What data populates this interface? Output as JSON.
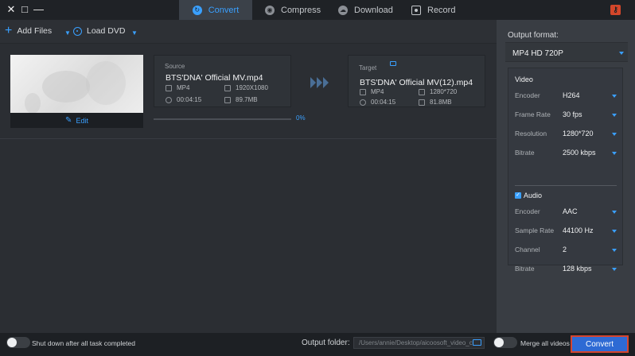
{
  "window": {
    "controls": [
      "✕",
      "□",
      "—"
    ]
  },
  "tabs": [
    {
      "label": "Convert",
      "icon": "convert-icon",
      "active": true
    },
    {
      "label": "Compress",
      "icon": "compress-icon",
      "active": false
    },
    {
      "label": "Download",
      "icon": "download-icon",
      "active": false
    },
    {
      "label": "Record",
      "icon": "record-icon",
      "active": false
    }
  ],
  "toolbar": {
    "add_files": "Add Files",
    "load_dvd": "Load DVD"
  },
  "task": {
    "edit_label": "Edit",
    "source": {
      "label": "Source",
      "filename": "BTS'DNA' Official MV.mp4",
      "format": "MP4",
      "resolution": "1920X1080",
      "duration": "00:04:15",
      "size": "89.7MB"
    },
    "target": {
      "label": "Target",
      "filename": "BTS'DNA' Official MV(12).mp4",
      "format": "MP4",
      "resolution": "1280*720",
      "duration": "00:04:15",
      "size": "81.8MB"
    },
    "progress": 0,
    "progress_text": "0%"
  },
  "output": {
    "label": "Output format:",
    "format": "MP4 HD 720P"
  },
  "video": {
    "title": "Video",
    "rows": [
      {
        "key": "Encoder",
        "value": "H264"
      },
      {
        "key": "Frame Rate",
        "value": "30 fps"
      },
      {
        "key": "Resolution",
        "value": "1280*720"
      },
      {
        "key": "Bitrate",
        "value": "2500 kbps"
      }
    ]
  },
  "audio": {
    "title": "Audio",
    "checked": true,
    "rows": [
      {
        "key": "Encoder",
        "value": "AAC"
      },
      {
        "key": "Sample Rate",
        "value": "44100 Hz"
      },
      {
        "key": "Channel",
        "value": "2"
      },
      {
        "key": "Bitrate",
        "value": "128 kbps"
      }
    ]
  },
  "bottom": {
    "shutdown_label": "Shut down after all task completed",
    "output_folder_label": "Output folder:",
    "output_folder_path": "/Users/annie/Desktop/aicoosoft_video_c",
    "merge_label": "Merge all videos",
    "convert_button": "Convert"
  },
  "colors": {
    "accent": "#3aa0ff",
    "convert_button": "#2e6ad4",
    "highlight_border": "#d5452f"
  }
}
